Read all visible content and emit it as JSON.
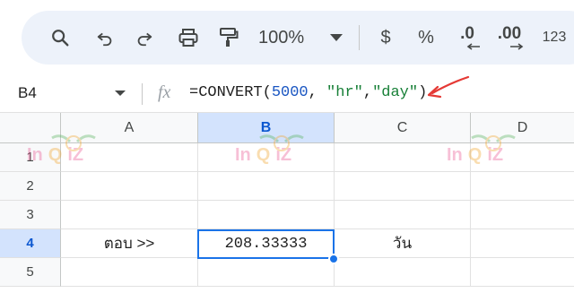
{
  "toolbar": {
    "zoom": "100%",
    "currency": "$",
    "percent": "%",
    "decrease_decimal": ".0",
    "increase_decimal": ".00",
    "number_format": "123"
  },
  "formula_bar": {
    "name_box": "B4",
    "fx": "fx",
    "formula_prefix": "=CONVERT(",
    "formula_number": "5000",
    "formula_sep1": ", ",
    "formula_str1": "\"hr\"",
    "formula_sep2": ",",
    "formula_str2": "\"day\"",
    "formula_suffix": ")"
  },
  "grid": {
    "columns": [
      "A",
      "B",
      "C",
      "D"
    ],
    "rows": [
      "1",
      "2",
      "3",
      "4",
      "5"
    ],
    "cells": {
      "A4": "ตอบ >>",
      "B4": "208.33333",
      "C4": "วัน"
    },
    "active_cell": "B4",
    "selected_column": "B",
    "selected_row": "4"
  },
  "watermark": {
    "part1": "In",
    "part2": "Q",
    "part3": "iZ"
  },
  "colors": {
    "selection": "#1a73e8",
    "header_selected_bg": "#d3e3fd",
    "formula_number": "#1a56c2",
    "formula_string": "#188038",
    "annotation_arrow": "#e53935"
  }
}
